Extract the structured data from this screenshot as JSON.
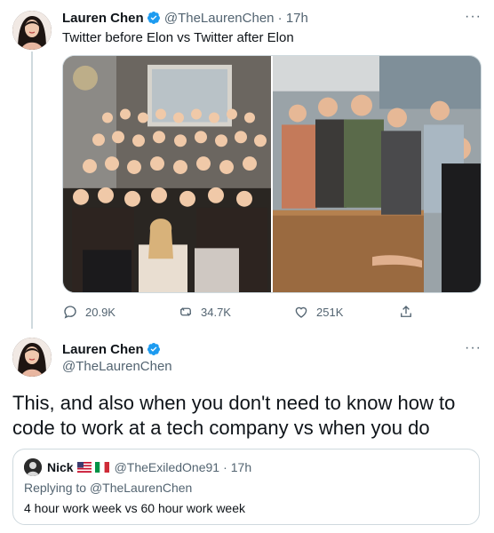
{
  "tweet1": {
    "author_name": "Lauren Chen",
    "handle": "@TheLaurenChen",
    "separator": "·",
    "time": "17h",
    "text": "Twitter before Elon vs Twitter after Elon",
    "more": "···",
    "stats": {
      "replies": "20.9K",
      "retweets": "34.7K",
      "likes": "251K"
    },
    "media": [
      {
        "icon": "group-photo-office-staff"
      },
      {
        "icon": "group-photo-engineers-thumbs-up"
      }
    ]
  },
  "tweet2": {
    "author_name": "Lauren Chen",
    "handle": "@TheLaurenChen",
    "more": "···",
    "text": "This, and also when you don't need to know how to code to work at a tech company vs when you do"
  },
  "quote": {
    "author_name": "Nick",
    "handle": "@TheExiledOne91",
    "separator": "·",
    "time": "17h",
    "replying_prefix": "Replying to",
    "replying_to": "@TheLaurenChen",
    "text": "4 hour work week vs 60 hour work week"
  },
  "colors": {
    "verified": "#1d9bf0",
    "secondary_text": "#536471",
    "border": "#cfd9de"
  }
}
